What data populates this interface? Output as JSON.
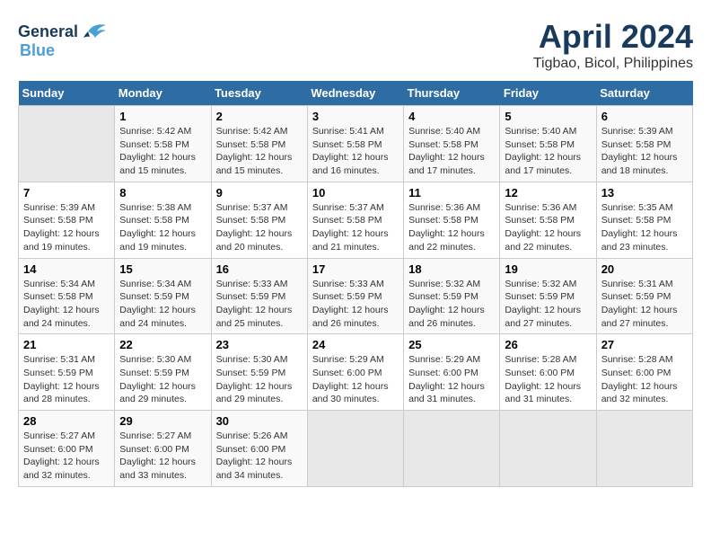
{
  "header": {
    "logo_line1": "General",
    "logo_line2": "Blue",
    "title": "April 2024",
    "subtitle": "Tigbao, Bicol, Philippines"
  },
  "calendar": {
    "days_of_week": [
      "Sunday",
      "Monday",
      "Tuesday",
      "Wednesday",
      "Thursday",
      "Friday",
      "Saturday"
    ],
    "weeks": [
      [
        {
          "day": "",
          "info": ""
        },
        {
          "day": "1",
          "info": "Sunrise: 5:42 AM\nSunset: 5:58 PM\nDaylight: 12 hours\nand 15 minutes."
        },
        {
          "day": "2",
          "info": "Sunrise: 5:42 AM\nSunset: 5:58 PM\nDaylight: 12 hours\nand 15 minutes."
        },
        {
          "day": "3",
          "info": "Sunrise: 5:41 AM\nSunset: 5:58 PM\nDaylight: 12 hours\nand 16 minutes."
        },
        {
          "day": "4",
          "info": "Sunrise: 5:40 AM\nSunset: 5:58 PM\nDaylight: 12 hours\nand 17 minutes."
        },
        {
          "day": "5",
          "info": "Sunrise: 5:40 AM\nSunset: 5:58 PM\nDaylight: 12 hours\nand 17 minutes."
        },
        {
          "day": "6",
          "info": "Sunrise: 5:39 AM\nSunset: 5:58 PM\nDaylight: 12 hours\nand 18 minutes."
        }
      ],
      [
        {
          "day": "7",
          "info": "Sunrise: 5:39 AM\nSunset: 5:58 PM\nDaylight: 12 hours\nand 19 minutes."
        },
        {
          "day": "8",
          "info": "Sunrise: 5:38 AM\nSunset: 5:58 PM\nDaylight: 12 hours\nand 19 minutes."
        },
        {
          "day": "9",
          "info": "Sunrise: 5:37 AM\nSunset: 5:58 PM\nDaylight: 12 hours\nand 20 minutes."
        },
        {
          "day": "10",
          "info": "Sunrise: 5:37 AM\nSunset: 5:58 PM\nDaylight: 12 hours\nand 21 minutes."
        },
        {
          "day": "11",
          "info": "Sunrise: 5:36 AM\nSunset: 5:58 PM\nDaylight: 12 hours\nand 22 minutes."
        },
        {
          "day": "12",
          "info": "Sunrise: 5:36 AM\nSunset: 5:58 PM\nDaylight: 12 hours\nand 22 minutes."
        },
        {
          "day": "13",
          "info": "Sunrise: 5:35 AM\nSunset: 5:58 PM\nDaylight: 12 hours\nand 23 minutes."
        }
      ],
      [
        {
          "day": "14",
          "info": "Sunrise: 5:34 AM\nSunset: 5:58 PM\nDaylight: 12 hours\nand 24 minutes."
        },
        {
          "day": "15",
          "info": "Sunrise: 5:34 AM\nSunset: 5:59 PM\nDaylight: 12 hours\nand 24 minutes."
        },
        {
          "day": "16",
          "info": "Sunrise: 5:33 AM\nSunset: 5:59 PM\nDaylight: 12 hours\nand 25 minutes."
        },
        {
          "day": "17",
          "info": "Sunrise: 5:33 AM\nSunset: 5:59 PM\nDaylight: 12 hours\nand 26 minutes."
        },
        {
          "day": "18",
          "info": "Sunrise: 5:32 AM\nSunset: 5:59 PM\nDaylight: 12 hours\nand 26 minutes."
        },
        {
          "day": "19",
          "info": "Sunrise: 5:32 AM\nSunset: 5:59 PM\nDaylight: 12 hours\nand 27 minutes."
        },
        {
          "day": "20",
          "info": "Sunrise: 5:31 AM\nSunset: 5:59 PM\nDaylight: 12 hours\nand 27 minutes."
        }
      ],
      [
        {
          "day": "21",
          "info": "Sunrise: 5:31 AM\nSunset: 5:59 PM\nDaylight: 12 hours\nand 28 minutes."
        },
        {
          "day": "22",
          "info": "Sunrise: 5:30 AM\nSunset: 5:59 PM\nDaylight: 12 hours\nand 29 minutes."
        },
        {
          "day": "23",
          "info": "Sunrise: 5:30 AM\nSunset: 5:59 PM\nDaylight: 12 hours\nand 29 minutes."
        },
        {
          "day": "24",
          "info": "Sunrise: 5:29 AM\nSunset: 6:00 PM\nDaylight: 12 hours\nand 30 minutes."
        },
        {
          "day": "25",
          "info": "Sunrise: 5:29 AM\nSunset: 6:00 PM\nDaylight: 12 hours\nand 31 minutes."
        },
        {
          "day": "26",
          "info": "Sunrise: 5:28 AM\nSunset: 6:00 PM\nDaylight: 12 hours\nand 31 minutes."
        },
        {
          "day": "27",
          "info": "Sunrise: 5:28 AM\nSunset: 6:00 PM\nDaylight: 12 hours\nand 32 minutes."
        }
      ],
      [
        {
          "day": "28",
          "info": "Sunrise: 5:27 AM\nSunset: 6:00 PM\nDaylight: 12 hours\nand 32 minutes."
        },
        {
          "day": "29",
          "info": "Sunrise: 5:27 AM\nSunset: 6:00 PM\nDaylight: 12 hours\nand 33 minutes."
        },
        {
          "day": "30",
          "info": "Sunrise: 5:26 AM\nSunset: 6:00 PM\nDaylight: 12 hours\nand 34 minutes."
        },
        {
          "day": "",
          "info": ""
        },
        {
          "day": "",
          "info": ""
        },
        {
          "day": "",
          "info": ""
        },
        {
          "day": "",
          "info": ""
        }
      ]
    ]
  }
}
